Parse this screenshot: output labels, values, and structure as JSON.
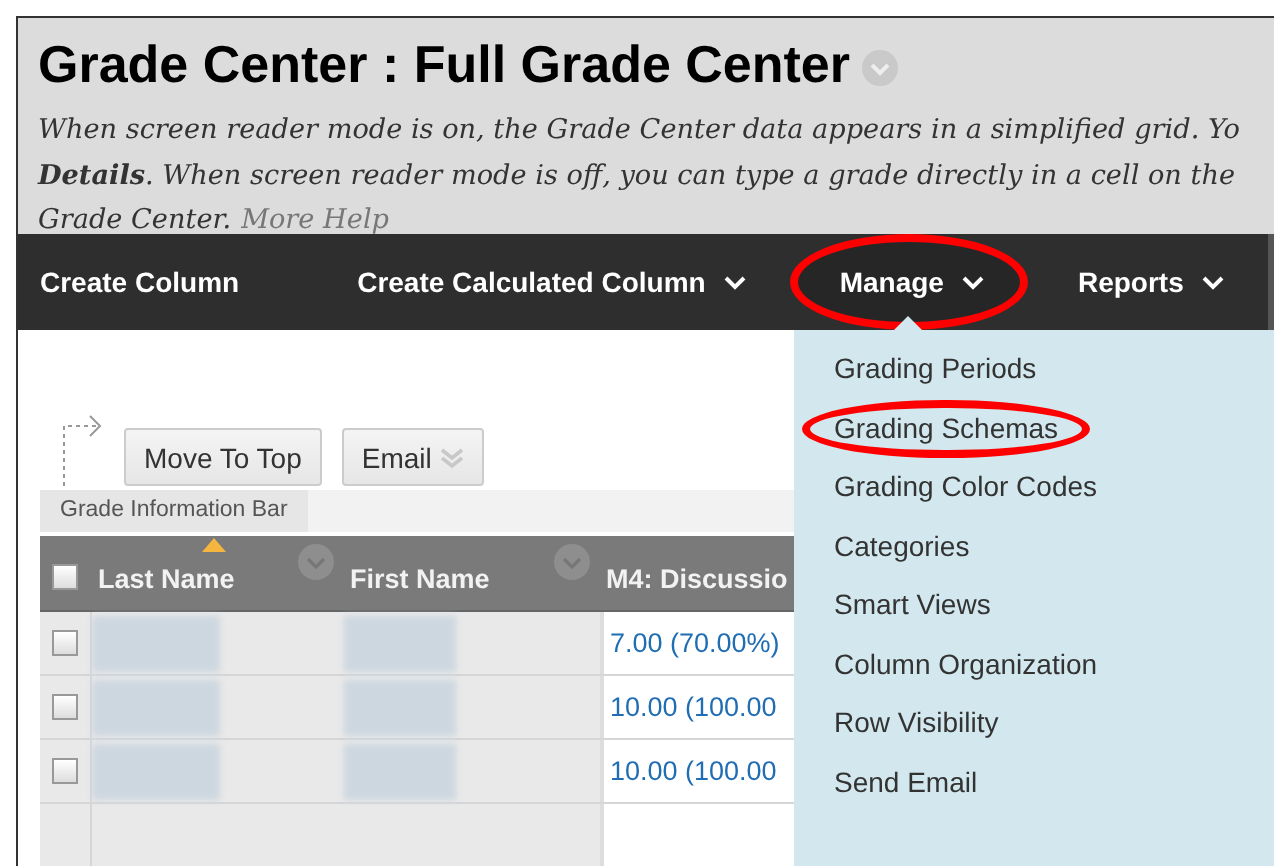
{
  "page_title": "Grade Center : Full Grade Center",
  "description_lines": [
    "When screen reader mode is on, the Grade Center data appears in a simplified grid. Yo",
    "**Details**. When screen reader mode is off, you can type a grade directly in a cell on the",
    "Grade Center."
  ],
  "help_link": "More Help",
  "nav_items": [
    {
      "label": "Create Column",
      "has_menu": false,
      "open": false,
      "highlighted": false
    },
    {
      "label": "Create Calculated Column",
      "has_menu": true,
      "open": false,
      "highlighted": false
    },
    {
      "label": "Manage",
      "has_menu": true,
      "open": true,
      "highlighted": true
    },
    {
      "label": "Reports",
      "has_menu": true,
      "open": false,
      "highlighted": false
    }
  ],
  "menu_items": [
    {
      "label": "Grading Periods",
      "highlighted": false
    },
    {
      "label": "Grading Schemas",
      "highlighted": true
    },
    {
      "label": "Grading Color Codes",
      "highlighted": false
    },
    {
      "label": "Categories",
      "highlighted": false
    },
    {
      "label": "Smart Views",
      "highlighted": false
    },
    {
      "label": "Column Organization",
      "highlighted": false
    },
    {
      "label": "Row Visibility",
      "highlighted": false
    },
    {
      "label": "Send Email",
      "highlighted": false
    }
  ],
  "toolbar_buttons": [
    {
      "label": "Move To Top",
      "has_menu": false
    },
    {
      "label": "Email",
      "has_menu": true
    }
  ],
  "info_bar": "Grade Information Bar",
  "table": {
    "columns": [
      {
        "label": "Last Name",
        "sorted": true
      },
      {
        "label": "First Name",
        "sorted": false
      },
      {
        "label": "M4: Discussio",
        "sorted": false
      }
    ],
    "all_checked": false,
    "rows": [
      {
        "checked": false,
        "grade": "7.00 (70.00%)"
      },
      {
        "checked": false,
        "grade": "10.00 (100.00"
      },
      {
        "checked": false,
        "grade": "10.00 (100.00"
      }
    ]
  }
}
